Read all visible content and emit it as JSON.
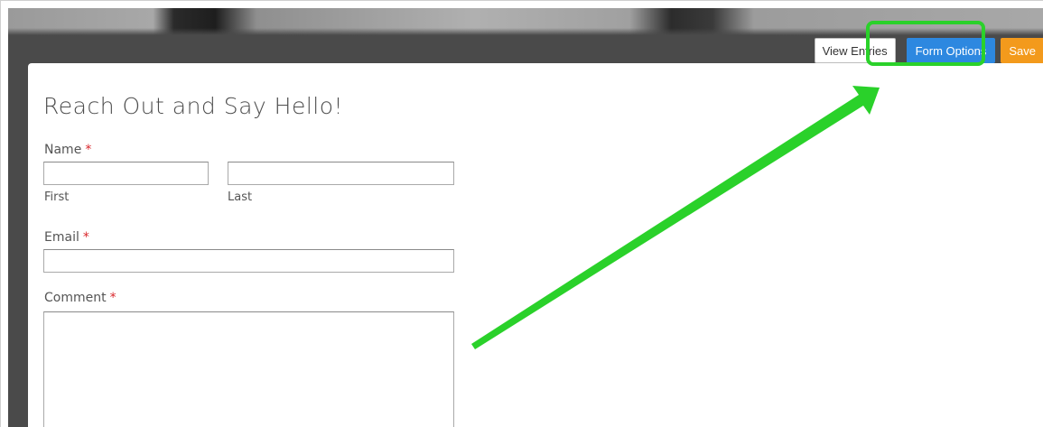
{
  "toolbar": {
    "view_entries_label": "View Entries",
    "form_options_label": "Form Options",
    "save_label": "Save"
  },
  "form": {
    "title": "Reach Out and Say Hello!",
    "required_marker": "*",
    "name": {
      "label": "Name",
      "first_sub": "First",
      "last_sub": "Last",
      "first_value": "",
      "last_value": ""
    },
    "email": {
      "label": "Email",
      "value": ""
    },
    "comment": {
      "label": "Comment",
      "value": ""
    }
  },
  "colors": {
    "form_options_bg": "#2d88e0",
    "save_bg": "#f39a1c",
    "highlight": "#2ad12a",
    "required": "#d9262b",
    "header_bg": "#4a4a4a"
  },
  "annotation": {
    "type": "arrow-callout",
    "target": "form-options-button"
  }
}
